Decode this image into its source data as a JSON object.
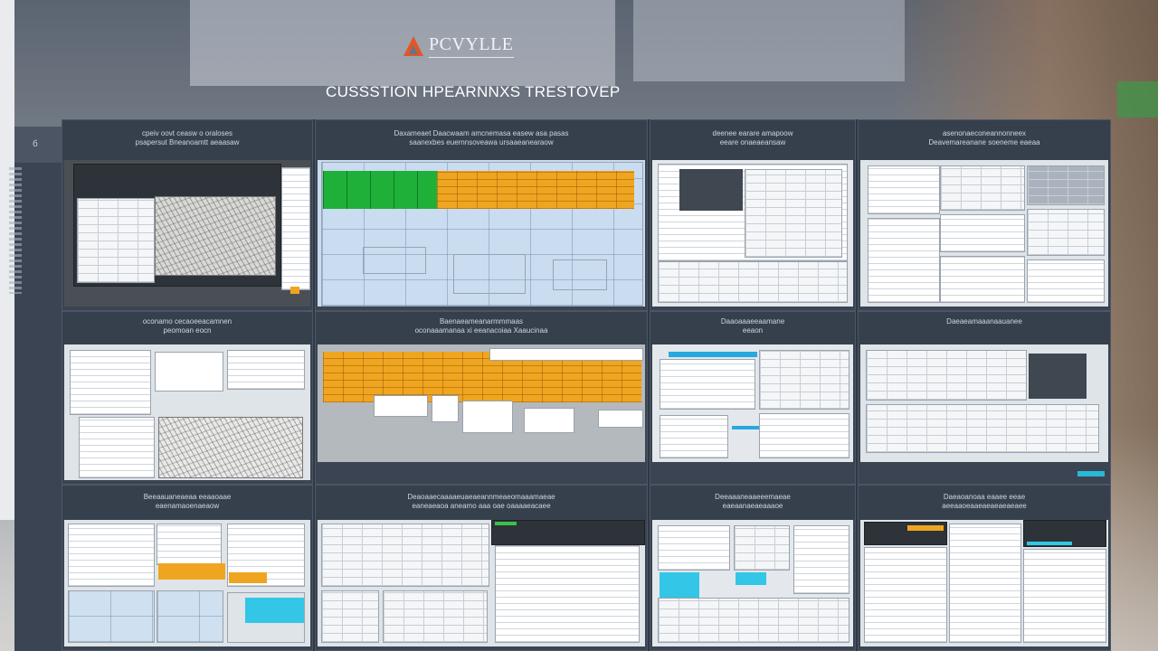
{
  "logo": {
    "text": "PCVYLLE"
  },
  "headline": "CUSSSTION HPEARNNXS TRESTOVEP",
  "side_rail": {
    "glyph": "б"
  },
  "panels": [
    {
      "line1": "cpeiv oovt ceasw o oraloses",
      "line2": "psapersut Bneanoamtt aeaasaw"
    },
    {
      "line1": "Daxameaet Daacwaam amcnemasa easew asa pasas",
      "line2": "saanexbes euernnsoveawa ursaaeanearaow"
    },
    {
      "line1": "deenee earare amapoow",
      "line2": "eeare onaeaeansaw"
    },
    {
      "line1": "asenonaeconeannonneex",
      "line2": "Deavemareanane soeneme eaeaa"
    },
    {
      "line1": "oconamo cecaoeeacamnen",
      "line2": "peomoan eocn"
    },
    {
      "line1": "Baenaeameanarmmmaas",
      "line2": "oconaaamanaa xi eeanacoiaa Xaaucinaa"
    },
    {
      "line1": "Daaoaaaeeaamane",
      "line2": "eeaon"
    },
    {
      "line1": "Daeaeamaaanaauanee",
      "line2": ""
    },
    {
      "line1": "Beeaauaneaeaa eeaaoaae",
      "line2": "eaenamaoenaeaow"
    },
    {
      "line1": "Deaoaaecaaaaeuaeaeannmeaeomaaamaeae",
      "line2": "eaneaeaoa aneamo aaa oae oaaaaeacaee"
    },
    {
      "line1": "Deeaaaneaaeeemaeae",
      "line2": "eaeaanaeaeaaaoe"
    },
    {
      "line1": "Daeaoanoaa eaaee eeae",
      "line2": "aeeaaoeaaeaeaeaeaeaee"
    }
  ]
}
